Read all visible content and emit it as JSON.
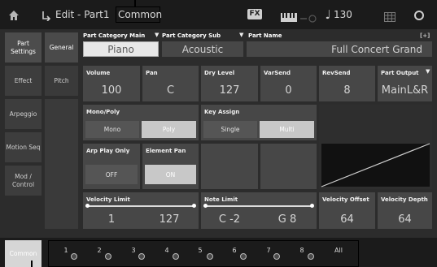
{
  "topbar": {
    "home_icon": "home-icon",
    "back_icon": "back-arrow-icon",
    "title": "Edit - Part1",
    "highlight": "Common",
    "fx_label": "FX",
    "keyboard_icon": "keyboard-icon",
    "midi_icon": "midi-icon",
    "tempo_icon": "quarter-note-icon",
    "tempo": "130",
    "grid_icon": "grid-icon",
    "record_icon": "circle-icon"
  },
  "sidebar": {
    "tabs": [
      {
        "label": "Part Settings",
        "active": true
      },
      {
        "label": "Effect",
        "active": false
      },
      {
        "label": "Arpeggio",
        "active": false
      },
      {
        "label": "Motion Seq",
        "active": false
      },
      {
        "label": "Mod / Control",
        "active": false
      }
    ],
    "subtabs": [
      {
        "label": "General",
        "active": true
      },
      {
        "label": "Pitch",
        "active": false
      }
    ]
  },
  "category": {
    "main_label": "Part Category Main",
    "main_value": "Piano",
    "sub_label": "Part Category Sub",
    "sub_value": "Acoustic",
    "name_label": "Part Name",
    "name_value": "Full Concert Grand",
    "name_marker": "[+]"
  },
  "params_row": {
    "volume": {
      "label": "Volume",
      "value": "100"
    },
    "pan": {
      "label": "Pan",
      "value": "C"
    },
    "dry_level": {
      "label": "Dry Level",
      "value": "127"
    },
    "var_send": {
      "label": "VarSend",
      "value": "0"
    },
    "rev_send": {
      "label": "RevSend",
      "value": "8"
    },
    "part_output": {
      "label": "Part Output",
      "value": "MainL&R"
    }
  },
  "mono_poly": {
    "label": "Mono/Poly",
    "options": [
      "Mono",
      "Poly"
    ],
    "selected": "Poly"
  },
  "key_assign": {
    "label": "Key Assign",
    "options": [
      "Single",
      "Multi"
    ],
    "selected": "Multi"
  },
  "arp_play_only": {
    "label": "Arp Play Only",
    "value": "OFF"
  },
  "element_pan": {
    "label": "Element Pan",
    "value": "ON"
  },
  "velocity_limit": {
    "label": "Velocity Limit",
    "low": "1",
    "high": "127"
  },
  "note_limit": {
    "label": "Note Limit",
    "low": "C -2",
    "high": "G 8"
  },
  "velocity_offset": {
    "label": "Velocity Offset",
    "value": "64"
  },
  "velocity_depth": {
    "label": "Velocity Depth",
    "value": "64"
  },
  "bottom": {
    "common_label": "Common",
    "parts": [
      "1",
      "2",
      "3",
      "4",
      "5",
      "6",
      "7",
      "8"
    ],
    "all_label": "All"
  },
  "colors": {
    "bar_bg": "#1b1b1b",
    "panel_bg": "#2c2c2c",
    "cell_bg": "#474747",
    "button_on": "#c8c8c8"
  }
}
